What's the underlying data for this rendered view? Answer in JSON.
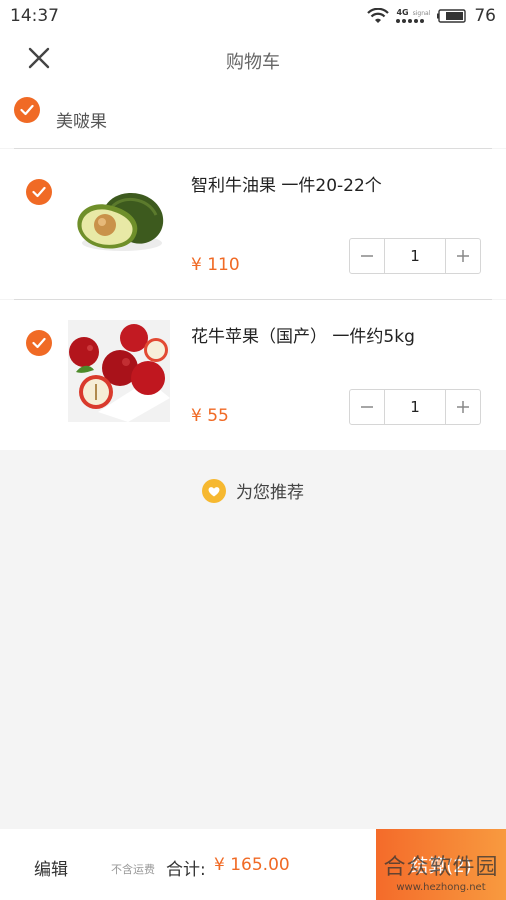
{
  "status_bar": {
    "time": "14:37",
    "network": "4G",
    "signal_label": "signal",
    "battery": "76"
  },
  "header": {
    "title": "购物车",
    "close_icon": "close-icon"
  },
  "store": {
    "name": "美啵果",
    "checked": true
  },
  "items": [
    {
      "name": "智利牛油果  一件20-22个",
      "price": "¥ 110",
      "quantity": "1",
      "checked": true,
      "image": "avocado"
    },
    {
      "name": "花牛苹果（国产）  一件约5kg",
      "price": "¥ 55",
      "quantity": "1",
      "checked": true,
      "image": "red-apples"
    }
  ],
  "recommend": {
    "label": "为您推荐",
    "icon": "heart-badge-icon"
  },
  "bottom_bar": {
    "edit_label": "编辑",
    "shipping_note": "不含运费",
    "total_label": "合计:",
    "total_value": "¥ 165.00",
    "checkout_label": "结算(2)"
  },
  "watermark": {
    "text": "合众软件园",
    "url": "www.hezhong.net"
  },
  "colors": {
    "accent": "#f06a25",
    "badge": "#f6b830",
    "background": "#f4f4f4"
  }
}
